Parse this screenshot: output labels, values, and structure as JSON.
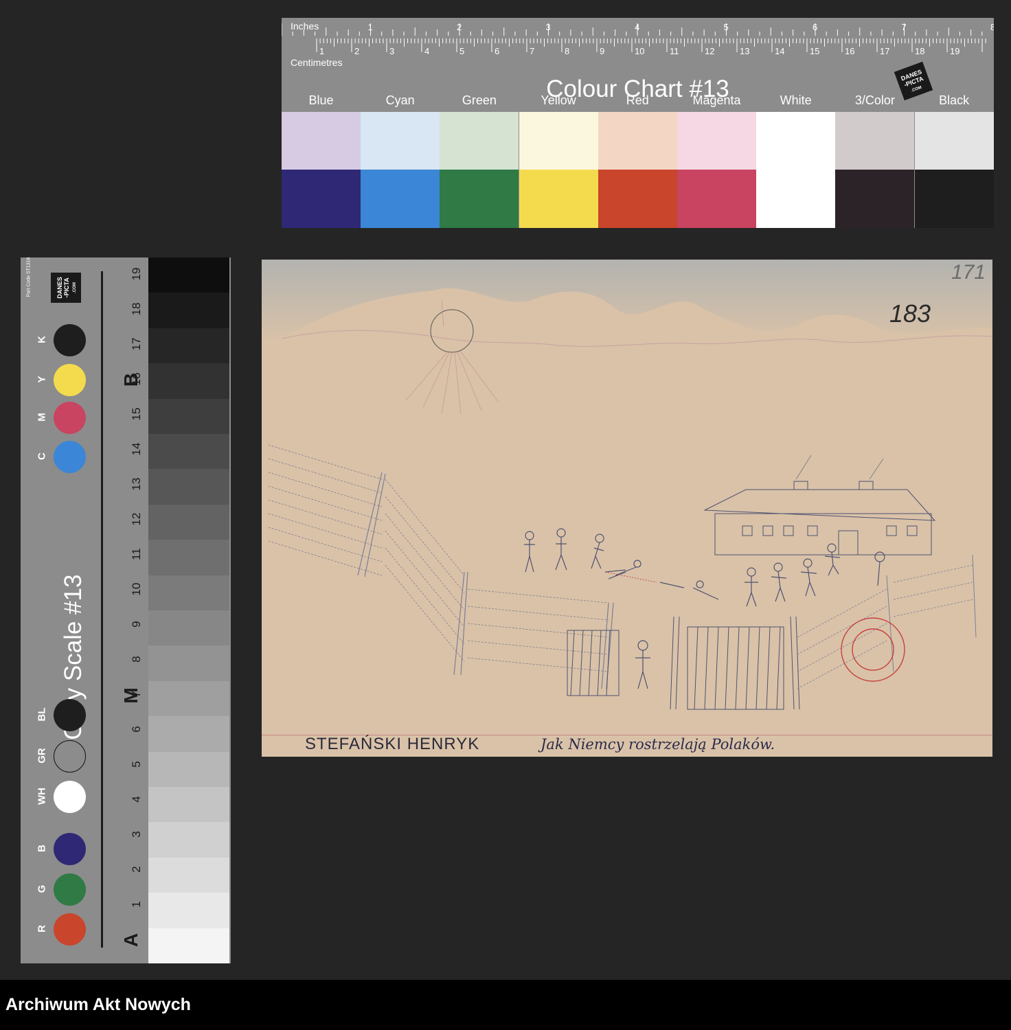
{
  "colour_chart": {
    "title": "Colour Chart #13",
    "inches_label": "Inches",
    "centimetres_label": "Centimetres",
    "inch_marks": [
      "1",
      "2",
      "3",
      "4",
      "5",
      "6",
      "7",
      "8"
    ],
    "cm_marks": [
      "1",
      "2",
      "3",
      "4",
      "5",
      "6",
      "7",
      "8",
      "9",
      "10",
      "11",
      "12",
      "13",
      "14",
      "15",
      "16",
      "17",
      "18",
      "19"
    ],
    "brand": "DANES-PICTA.COM",
    "columns": [
      {
        "name": "Blue",
        "light": "#d7cbe4",
        "dark": "#2e2875"
      },
      {
        "name": "Cyan",
        "light": "#d9e6f3",
        "dark": "#3b86d6"
      },
      {
        "name": "Green",
        "light": "#d6e3d3",
        "dark": "#2f7a45"
      },
      {
        "name": "Yellow",
        "light": "#fbf7de",
        "dark": "#f4db4e"
      },
      {
        "name": "Red",
        "light": "#f4d6c4",
        "dark": "#c9452b"
      },
      {
        "name": "Magenta",
        "light": "#f5d8e3",
        "dark": "#c84460"
      },
      {
        "name": "White",
        "light": "#ffffff",
        "dark": "#ffffff"
      },
      {
        "name": "3/Color",
        "light": "#d2cbcb",
        "dark": "#2b2328"
      },
      {
        "name": "Black",
        "light": "#e4e4e4",
        "dark": "#1e1e1e"
      }
    ]
  },
  "grey_scale": {
    "title": "Grey Scale #13",
    "part_code": "Part Code ST1316",
    "brand": "DANES-PICTA.COM",
    "labels_letters": [
      "A",
      "M",
      "B"
    ],
    "step_numbers": [
      "1",
      "2",
      "3",
      "4",
      "5",
      "6",
      "7",
      "8",
      "9",
      "10",
      "11",
      "12",
      "13",
      "14",
      "15",
      "16",
      "17",
      "18",
      "19"
    ],
    "patches": [
      {
        "label": "R",
        "color": "#c9452b"
      },
      {
        "label": "G",
        "color": "#2f7a45"
      },
      {
        "label": "B",
        "color": "#2e2875"
      },
      {
        "label": "WH",
        "color": "#ffffff"
      },
      {
        "label": "GR",
        "color": "#8c8c8c"
      },
      {
        "label": "BL",
        "color": "#1e1e1e"
      },
      {
        "label": "C",
        "color": "#3b86d6"
      },
      {
        "label": "M",
        "color": "#c84460"
      },
      {
        "label": "Y",
        "color": "#f4db4e"
      },
      {
        "label": "K",
        "color": "#1e1e1e"
      }
    ]
  },
  "drawing": {
    "page_number_top": "171",
    "page_number": "183",
    "author": "STEFAŃSKI HENRYK",
    "caption": "Jak Niemcy rostrzelają Polaków."
  },
  "footer": {
    "archive_name": "Archiwum Akt Nowych"
  }
}
